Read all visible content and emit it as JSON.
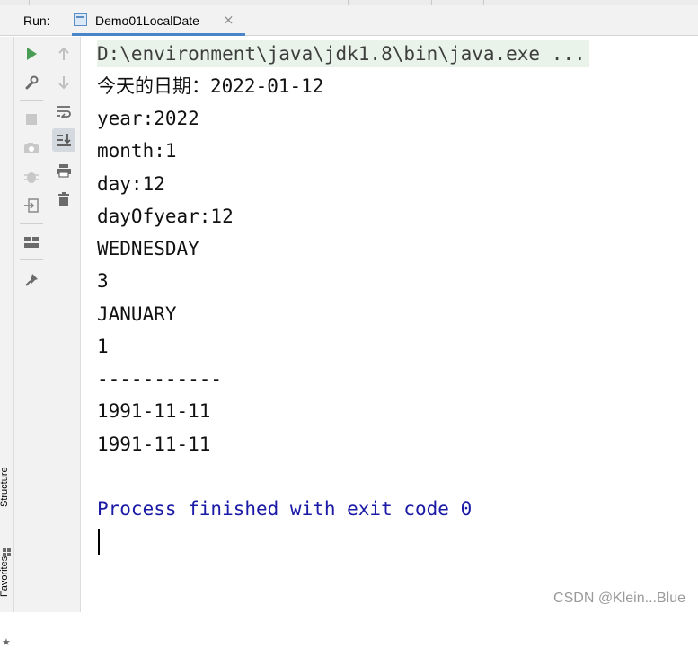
{
  "run_panel": {
    "label": "Run:",
    "tab": {
      "title": "Demo01LocalDate",
      "close_glyph": "×"
    }
  },
  "toolbar": {
    "primary": [
      {
        "name": "rerun-icon",
        "glyph": "▶",
        "color": "#499c54"
      },
      {
        "name": "wrench-icon",
        "glyph": "🔧",
        "color": "#6b6b6b"
      },
      {
        "name": "stop-icon",
        "glyph": "■",
        "color": "#c8c8c8"
      },
      {
        "name": "camera-icon",
        "glyph": "📷",
        "color": "#c8c8c8"
      },
      {
        "name": "debug-icon",
        "glyph": "✱",
        "color": "#c8c8c8"
      },
      {
        "name": "exit-icon",
        "glyph": "⇥",
        "color": "#8a8a8a"
      },
      {
        "name": "layout-icon",
        "glyph": "▦",
        "color": "#6b6b6b"
      },
      {
        "name": "pin-icon",
        "glyph": "📌",
        "color": "#6b6b6b"
      }
    ],
    "secondary": [
      {
        "name": "arrow-up-icon",
        "glyph": "↑",
        "color": "#c0c0c0"
      },
      {
        "name": "arrow-down-icon",
        "glyph": "↓",
        "color": "#c0c0c0"
      },
      {
        "name": "soft-wrap-icon",
        "glyph": "⤶",
        "color": "#6b6b6b"
      },
      {
        "name": "scroll-to-end-icon",
        "glyph": "⤓",
        "color": "#555555"
      },
      {
        "name": "print-icon",
        "glyph": "🖶",
        "color": "#6b6b6b"
      },
      {
        "name": "trash-icon",
        "glyph": "🗑",
        "color": "#6b6b6b"
      }
    ]
  },
  "side_panel": {
    "structure_label": "Structure",
    "favorites_label": "Favorites"
  },
  "console": {
    "command": "D:\\environment\\java\\jdk1.8\\bin\\java.exe ...",
    "output_lines": [
      "今天的日期：2022-01-12",
      "year:2022",
      "month:1",
      "day:12",
      "dayOfyear:12",
      "WEDNESDAY",
      "3",
      "JANUARY",
      "1",
      "-----------",
      "1991-11-11",
      "1991-11-11"
    ],
    "exit_message": "Process finished with exit code 0"
  },
  "watermark": "CSDN @Klein...Blue"
}
